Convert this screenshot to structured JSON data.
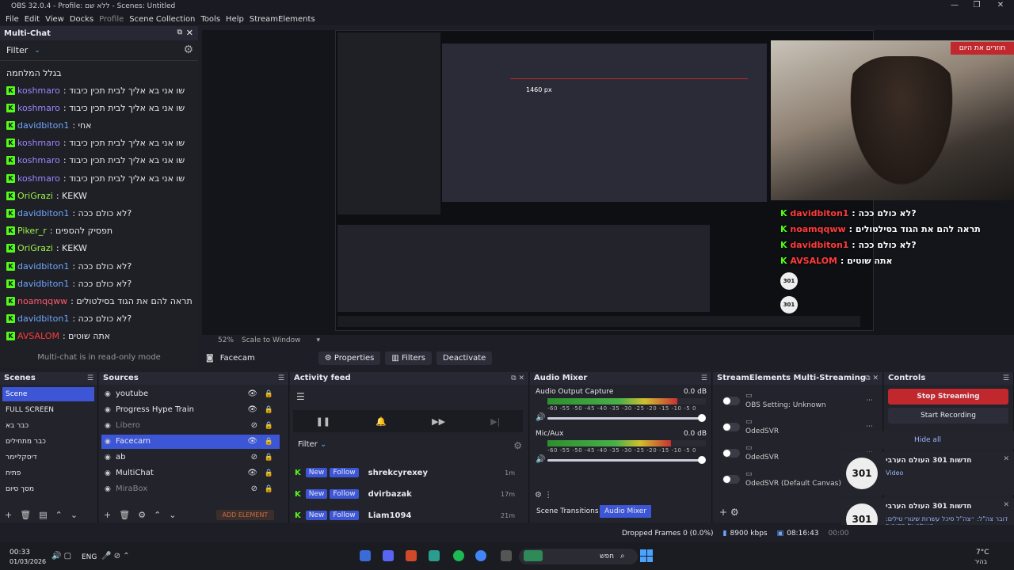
{
  "window": {
    "title": "OBS 32.0.4 - Profile: ללא שם - Scenes: Untitled"
  },
  "menu": [
    "File",
    "Edit",
    "View",
    "Docks",
    "Profile",
    "Scene Collection",
    "Tools",
    "Help",
    "StreamElements"
  ],
  "multichat": {
    "title": "Multi-Chat",
    "filter_label": "Filter",
    "first_line": "בגלל המלחמה",
    "messages": [
      {
        "user": "koshmaro",
        "text": ": שו אני בא אליך לבית תכין כיבוד",
        "color": "#9b86ff"
      },
      {
        "user": "koshmaro",
        "text": ": שו אני בא אליך לבית תכין כיבוד",
        "color": "#9b86ff"
      },
      {
        "user": "davidbiton1",
        "text": ": אחי",
        "color": "#6ea6ff"
      },
      {
        "user": "koshmaro",
        "text": ": שו אני בא אליך לבית תכין כיבוד",
        "color": "#9b86ff"
      },
      {
        "user": "koshmaro",
        "text": ": שו אני בא אליך לבית תכין כיבוד",
        "color": "#9b86ff"
      },
      {
        "user": "koshmaro",
        "text": ": שו אני בא אליך לבית תכין כיבוד",
        "color": "#9b86ff"
      },
      {
        "user": "OriGrazi",
        "text": ": KEKW",
        "color": "#9ef54a"
      },
      {
        "user": "davidbiton1",
        "text": ": לא כולם ככה?",
        "color": "#6ea6ff"
      },
      {
        "user": "Piker_r",
        "text": ": תפסיק להספים",
        "color": "#9ef54a"
      },
      {
        "user": "OriGrazi",
        "text": ": KEKW",
        "color": "#9ef54a"
      },
      {
        "user": "davidbiton1",
        "text": ": לא כולם ככה?",
        "color": "#6ea6ff"
      },
      {
        "user": "davidbiton1",
        "text": ": לא כולם ככה?",
        "color": "#6ea6ff"
      },
      {
        "user": "noamqqww",
        "text": ": תראה להם את הגוד בסילטולים",
        "color": "#ff5a6e"
      },
      {
        "user": "davidbiton1",
        "text": ": לא כולם ככה?",
        "color": "#6ea6ff"
      },
      {
        "user": "AVSALOM",
        "text": ": אתה שוטים",
        "color": "#ff3b3b"
      }
    ],
    "readonly_note": "Multi-chat is in read-only mode"
  },
  "preview": {
    "zoom": "52%",
    "scale_mode": "Scale to Window",
    "overlay_banner": "חוזרים את היום",
    "overlay_chat": [
      {
        "user": "davidbiton1",
        "text": ": לא כולם ככה?",
        "color": "#ff3b3b"
      },
      {
        "user": "noamqqww",
        "text": ": תראה להם את הגוד בסילטולים",
        "color": "#ff3b3b"
      },
      {
        "user": "davidbiton1",
        "text": ": לא כולם ככה?",
        "color": "#ff3b3b"
      },
      {
        "user": "AVSALOM",
        "text": ": אתה שוטים",
        "color": "#ff3b3b"
      }
    ],
    "inner_measure": "1460 px"
  },
  "source_toolbar": {
    "source_name": "Facecam",
    "properties": "Properties",
    "filters": "Filters",
    "deactivate": "Deactivate"
  },
  "scenes": {
    "title": "Scenes",
    "items": [
      "Scene",
      "FULL SCREEN",
      "כבר בא",
      "כבר מתחילים",
      "דיסקליימר",
      "פתיח",
      "מסך סיום"
    ],
    "selected": 0
  },
  "sources": {
    "title": "Sources",
    "items": [
      {
        "name": "youtube",
        "dim": false,
        "sel": false,
        "eye": true
      },
      {
        "name": "Progress Hype Train",
        "dim": false,
        "sel": false,
        "eye": true
      },
      {
        "name": "Libero",
        "dim": true,
        "sel": false,
        "eye": false
      },
      {
        "name": "Facecam",
        "dim": false,
        "sel": true,
        "eye": true
      },
      {
        "name": "ab",
        "dim": false,
        "sel": false,
        "eye": false
      },
      {
        "name": "MultiChat",
        "dim": false,
        "sel": false,
        "eye": true
      },
      {
        "name": "MiraBox",
        "dim": true,
        "sel": false,
        "eye": false
      }
    ],
    "add_element": "ADD ELEMENT"
  },
  "activity": {
    "title": "Activity feed",
    "filter": "Filter",
    "rows": [
      {
        "badge_new": "New",
        "badge_follow": "Follow",
        "name": "shrekcyrexey",
        "time": "1m"
      },
      {
        "badge_new": "New",
        "badge_follow": "Follow",
        "name": "dvirbazak",
        "time": "17m"
      },
      {
        "badge_new": "New",
        "badge_follow": "Follow",
        "name": "Liam1094",
        "time": "21m"
      }
    ]
  },
  "mixer": {
    "title": "Audio Mixer",
    "channels": [
      {
        "name": "Audio Output Capture",
        "db": "0.0 dB",
        "level": 0.82
      },
      {
        "name": "Mic/Aux",
        "db": "0.0 dB",
        "level": 0.78
      }
    ],
    "scale": "-60 -55 -50 -45 -40 -35 -30 -25 -20 -15 -10 -5 0",
    "tab_transitions": "Scene Transitions",
    "tab_mixer": "Audio Mixer"
  },
  "se": {
    "title": "StreamElements Multi-Streaming",
    "rows": [
      {
        "label": "OBS Setting: Unknown"
      },
      {
        "label": "OdedSVR"
      },
      {
        "label": "OdedSVR"
      },
      {
        "label": "OdedSVR (Default Canvas)"
      }
    ]
  },
  "controls": {
    "title": "Controls",
    "stop_streaming": "Stop Streaming",
    "start_recording": "Start Recording",
    "hide_all": "Hide all"
  },
  "notifications": [
    {
      "title": "חדשות 301 העולם הערבי",
      "sub": "Video",
      "logo": "301"
    },
    {
      "title": "חדשות 301 העולם הערבי",
      "sub": "דובר צה\"ל: ״צה\"ל סיכל עשרות שיגורי טילים: הושלם גל תקיפות...",
      "logo": "301"
    }
  ],
  "status": {
    "dropped": "Dropped Frames 0 (0.0%)",
    "kbps": "8900 kbps",
    "time": "08:16:43",
    "time2": "00:00"
  },
  "taskbar": {
    "clock": "00:33",
    "date": "01/03/2026",
    "lang": "ENG",
    "search": "חפש",
    "weather": "7°C",
    "weather_sub": "בהיר"
  },
  "colors": {
    "accent": "#3c56d6",
    "stop": "#c0282d",
    "kick": "#53fc18"
  }
}
